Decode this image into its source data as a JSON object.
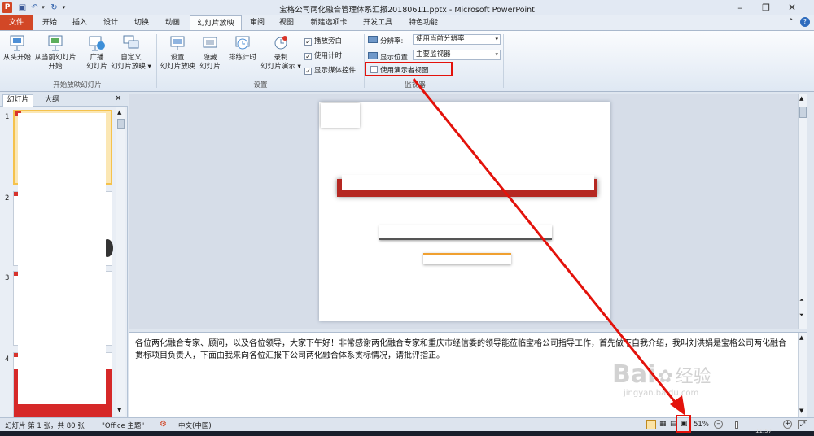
{
  "app": {
    "window_title": "宝格公司两化融合管理体系汇报20180611.pptx - Microsoft PowerPoint",
    "ppt_badge": "P"
  },
  "tabs": [
    "文件",
    "开始",
    "插入",
    "设计",
    "切换",
    "动画",
    "幻灯片放映",
    "审阅",
    "视图",
    "新建选项卡",
    "开发工具",
    "特色功能"
  ],
  "ribbon": {
    "start_group": {
      "from_beginning": "从头开始",
      "from_current_1": "从当前幻灯片",
      "from_current_2": "开始",
      "broadcast_1": "广播",
      "broadcast_2": "幻灯片",
      "custom_1": "自定义",
      "custom_2": "幻灯片放映 ▾",
      "label": "开始放映幻灯片"
    },
    "setup_group": {
      "setup_1": "设置",
      "setup_2": "幻灯片放映",
      "hide_1": "隐藏",
      "hide_2": "幻灯片",
      "rehearse": "排练计时",
      "record_1": "录制",
      "record_2": "幻灯片演示 ▾",
      "play_narrations": "播放旁白",
      "use_timings": "使用计时",
      "show_media_controls": "显示媒体控件",
      "label": "设置"
    },
    "monitors_group": {
      "resolution_label": "分辨率:",
      "resolution_value": "使用当前分辨率",
      "show_on_label": "显示位置:",
      "show_on_value": "主要监视器",
      "presenter_view": "使用演示者视图",
      "label": "监视器"
    }
  },
  "left_pane": {
    "tab_slides": "幻灯片",
    "tab_outline": "大纲",
    "close": "✕",
    "slide_numbers": [
      "1",
      "2",
      "3",
      "4"
    ]
  },
  "notes_text": "各位两化融合专家、顾问，以及各位领导，大家下午好！非常感谢两化融合专家和重庆市经信委的领导能莅临宝格公司指导工作，首先做下自我介绍，我叫刘洪娟是宝格公司两化融合贯标项目负责人，下面由我来向各位汇报下公司两化融合体系贯标情况，请批评指正。",
  "status": {
    "slide_info": "幻灯片 第 1 张，共 80 张",
    "theme": "\"Office 主题\"",
    "language": "中文(中国)",
    "zoom": "51%",
    "clock": "11:57"
  },
  "watermark": {
    "brand": "Bai",
    "brand_cn": "经验",
    "url": "jingyan.baidu.com"
  },
  "colors": {
    "file_tab": "#d24726",
    "annotation_red": "#e3120b",
    "accent_orange": "#f0a030"
  }
}
